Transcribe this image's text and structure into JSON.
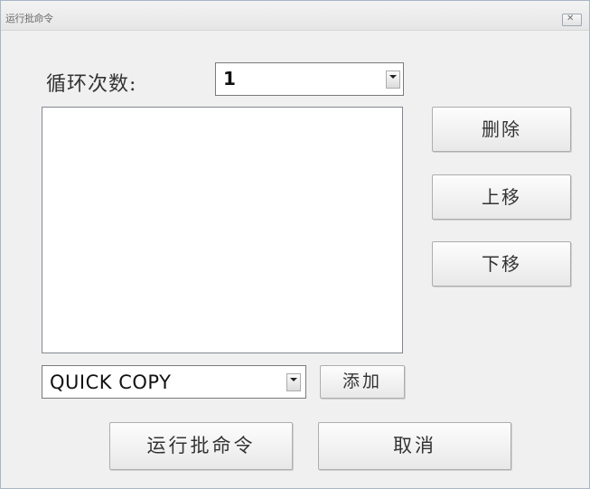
{
  "window": {
    "title": "运行批命令",
    "close_glyph": "✕"
  },
  "loop": {
    "label": "循环次数:",
    "value": "1"
  },
  "list": {
    "items": []
  },
  "buttons": {
    "delete": "删除",
    "move_up": "上移",
    "move_down": "下移",
    "add": "添加",
    "run": "运行批命令",
    "cancel": "取消"
  },
  "command_select": {
    "value": "QUICK COPY"
  }
}
